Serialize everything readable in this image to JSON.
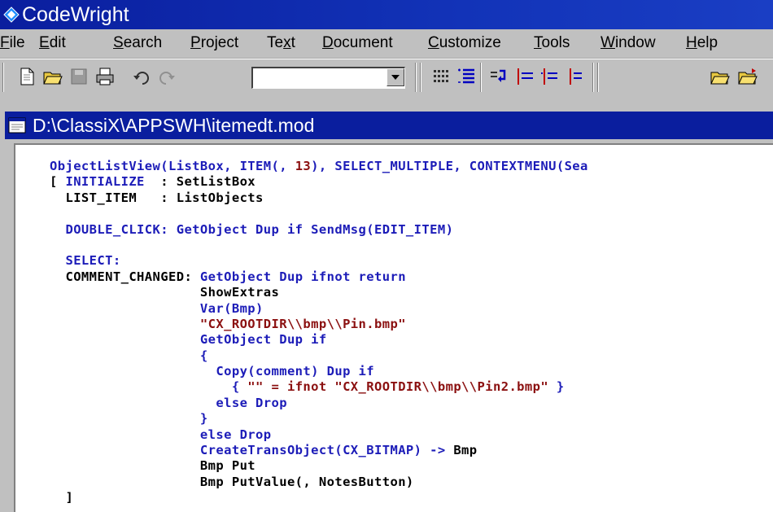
{
  "app": {
    "title": "CodeWright",
    "icon": "codewright-logo-icon"
  },
  "menu": {
    "items": [
      {
        "pre": "",
        "u": "F",
        "post": "ile"
      },
      {
        "pre": "",
        "u": "E",
        "post": "dit"
      },
      {
        "pre": "",
        "u": "S",
        "post": "earch"
      },
      {
        "pre": "",
        "u": "P",
        "post": "roject"
      },
      {
        "pre": "Te",
        "u": "x",
        "post": "t"
      },
      {
        "pre": "",
        "u": "D",
        "post": "ocument"
      },
      {
        "pre": "",
        "u": "C",
        "post": "ustomize"
      },
      {
        "pre": "",
        "u": "T",
        "post": "ools"
      },
      {
        "pre": "",
        "u": "W",
        "post": "indow"
      },
      {
        "pre": "",
        "u": "H",
        "post": "elp"
      }
    ]
  },
  "toolbar": {
    "combo_value": "",
    "icons": [
      "new-file-icon",
      "open-folder-icon",
      "save-icon",
      "print-icon",
      "undo-icon",
      "redo-icon",
      "dropdown-arrow-icon",
      "columns-icon",
      "list-icon",
      "wrap-icon",
      "indent-icon",
      "outdent-icon",
      "tab-icon",
      "open-project-icon",
      "open-folder-2-icon"
    ]
  },
  "document": {
    "title": "D:\\ClassiX\\APPSWH\\itemedt.mod",
    "icon": "document-icon"
  },
  "colors": {
    "title_bar": "#0a1e9e",
    "code_blue": "#1c1cb8",
    "code_red": "#8b1010",
    "chrome": "#c0c0c0"
  },
  "code": [
    {
      "k": "ObjectListView(ListBox, ITEM(, ",
      "n": "13",
      "r": "), SELECT_MULTIPLE, CONTEXTMENU(Sea"
    },
    {
      "a": "[ ",
      "k": "INITIALIZE",
      "b": "  : SetListBox"
    },
    {
      "a": "  LIST_ITEM   : ListObjects"
    },
    {
      "a": ""
    },
    {
      "k": "  DOUBLE_CLICK: GetObject Dup if SendMsg(EDIT_ITEM)"
    },
    {
      "a": ""
    },
    {
      "k": "  SELECT:"
    },
    {
      "a": "  COMMENT_CHANGED: ",
      "k": "GetObject Dup ifnot return"
    },
    {
      "a": "                   ShowExtras"
    },
    {
      "k": "                   Var(Bmp)"
    },
    {
      "s": "                   \"CX_ROOTDIR\\\\bmp\\\\Pin.bmp\""
    },
    {
      "k": "                   GetObject Dup if"
    },
    {
      "k": "                   {"
    },
    {
      "k": "                     Copy(comment) Dup if"
    },
    {
      "k": "                       { ",
      "s": "\"\" = ifnot \"CX_ROOTDIR\\\\bmp\\\\Pin2.bmp\"",
      "k2": " }"
    },
    {
      "k": "                     else Drop"
    },
    {
      "k": "                   }"
    },
    {
      "k": "                   else Drop"
    },
    {
      "k": "                   CreateTransObject(CX_BITMAP) -> ",
      "b": "Bmp"
    },
    {
      "a": "                   Bmp Put"
    },
    {
      "a": "                   Bmp PutValue(, NotesButton)"
    },
    {
      "a": "  ]"
    }
  ]
}
